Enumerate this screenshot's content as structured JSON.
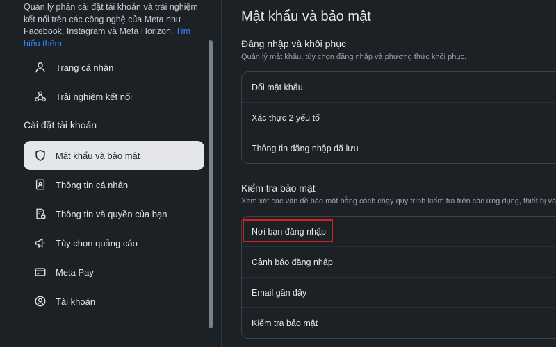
{
  "sidebar": {
    "intro_text": "Quản lý phần cài đặt tài khoản và trải nghiệm kết nối trên các công nghệ của Meta như Facebook, Instagram và Meta Horizon. ",
    "intro_link": "Tìm hiểu thêm",
    "top_items": [
      {
        "label": "Trang cá nhân",
        "icon": "profile-icon"
      },
      {
        "label": "Trải nghiệm kết nối",
        "icon": "connected-experiences-icon"
      }
    ],
    "section_heading": "Cài đặt tài khoản",
    "account_items": [
      {
        "label": "Mật khẩu và bảo mật",
        "icon": "shield-icon",
        "active": true
      },
      {
        "label": "Thông tin cá nhân",
        "icon": "id-card-icon"
      },
      {
        "label": "Thông tin và quyền của bạn",
        "icon": "document-lock-icon"
      },
      {
        "label": "Tùy chọn quảng cáo",
        "icon": "megaphone-icon"
      },
      {
        "label": "Meta Pay",
        "icon": "credit-card-icon"
      },
      {
        "label": "Tài khoản",
        "icon": "account-circle-icon"
      }
    ]
  },
  "main": {
    "title": "Mật khẩu và bảo mật",
    "login_section": {
      "title": "Đăng nhập và khôi phục",
      "description": "Quản lý mật khẩu, tùy chọn đăng nhập và phương thức khôi phục.",
      "items": [
        "Đổi mật khẩu",
        "Xác thực 2 yếu tố",
        "Thông tin đăng nhập đã lưu"
      ]
    },
    "security_section": {
      "title": "Kiểm tra bảo mật",
      "description": "Xem xét các vấn đề bảo mật bằng cách chạy quy trình kiểm tra trên các ứng dụng, thiết bị và",
      "items": [
        "Nơi bạn đăng nhập",
        "Cảnh báo đăng nhập",
        "Email gần đây",
        "Kiểm tra bảo mật"
      ]
    }
  },
  "colors": {
    "background": "#1c2126",
    "active_item_bg": "#e4e6eb",
    "link": "#2d88ff",
    "highlight_box": "#d61e1e"
  }
}
